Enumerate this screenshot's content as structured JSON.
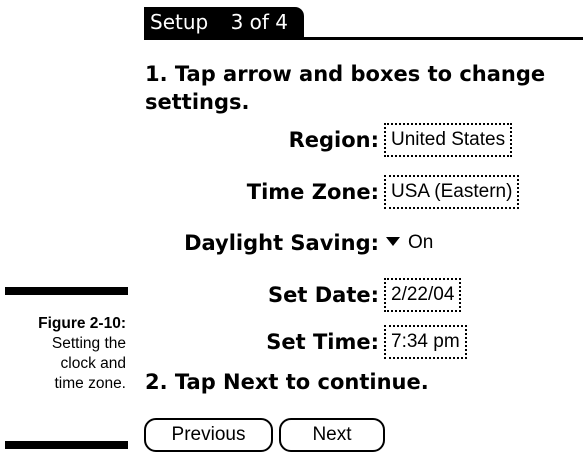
{
  "caption": {
    "figure_label": "Figure 2-10:",
    "lines": [
      "Setting the",
      "clock and",
      "time zone."
    ]
  },
  "header": {
    "title": "Setup",
    "step": "3 of 4"
  },
  "instructions": {
    "step1": "1. Tap arrow and boxes to change settings.",
    "step2": "2. Tap Next to continue."
  },
  "settings": {
    "region": {
      "label": "Region:",
      "value": "United States"
    },
    "time_zone": {
      "label": "Time Zone:",
      "value": "USA (Eastern)"
    },
    "daylight_saving": {
      "label": "Daylight Saving:",
      "value": "On",
      "icon": "triangle-down-icon"
    },
    "date": {
      "label": "Set Date:",
      "value": "2/22/04"
    },
    "time": {
      "label": "Set Time:",
      "value": "7:34 pm"
    }
  },
  "buttons": {
    "previous": "Previous",
    "next": "Next"
  }
}
